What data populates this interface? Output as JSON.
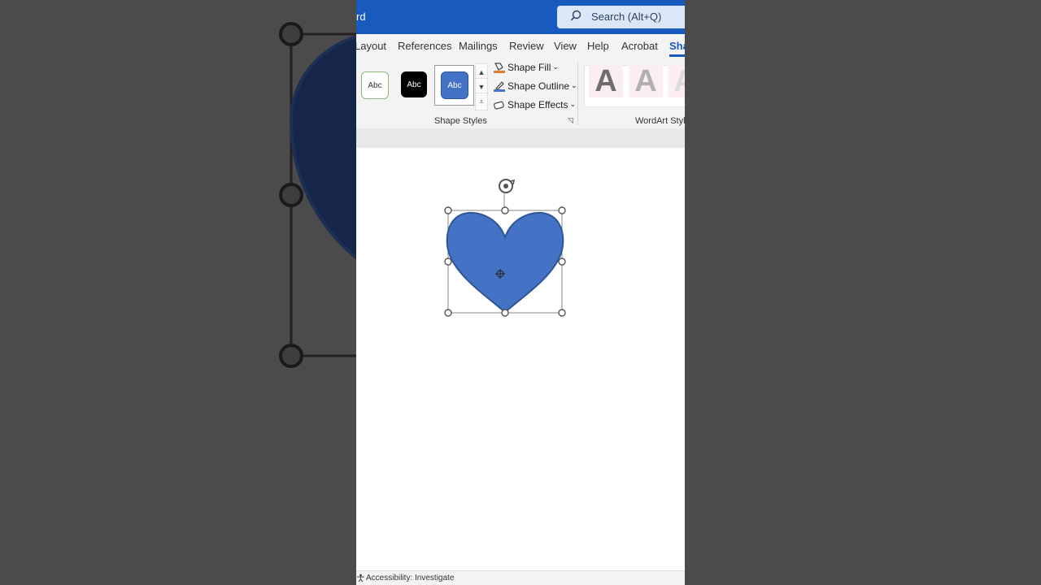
{
  "window": {
    "title_fragment": "rd"
  },
  "search": {
    "label": "Search (Alt+Q)",
    "icon": "search-icon"
  },
  "tabs": [
    {
      "label": "Layout",
      "active": false
    },
    {
      "label": "References",
      "active": false
    },
    {
      "label": "Mailings",
      "active": false
    },
    {
      "label": "Review",
      "active": false
    },
    {
      "label": "View",
      "active": false
    },
    {
      "label": "Help",
      "active": false
    },
    {
      "label": "Acrobat",
      "active": false
    },
    {
      "label": "Sha",
      "active": true
    }
  ],
  "shape_styles": {
    "swatches": [
      "Abc",
      "Abc",
      "Abc"
    ],
    "group_label": "Shape Styles",
    "commands": {
      "fill": "Shape Fill",
      "outline": "Shape Outline",
      "effects": "Shape Effects"
    }
  },
  "wordart": {
    "letters": [
      "A",
      "A",
      "A"
    ],
    "group_label": "WordArt Styles"
  },
  "status": {
    "accessibility": "Accessibility: Investigate"
  },
  "colors": {
    "accent": "#185abd",
    "heart_fill": "#4472c4",
    "heart_stroke": "#2f5597"
  }
}
